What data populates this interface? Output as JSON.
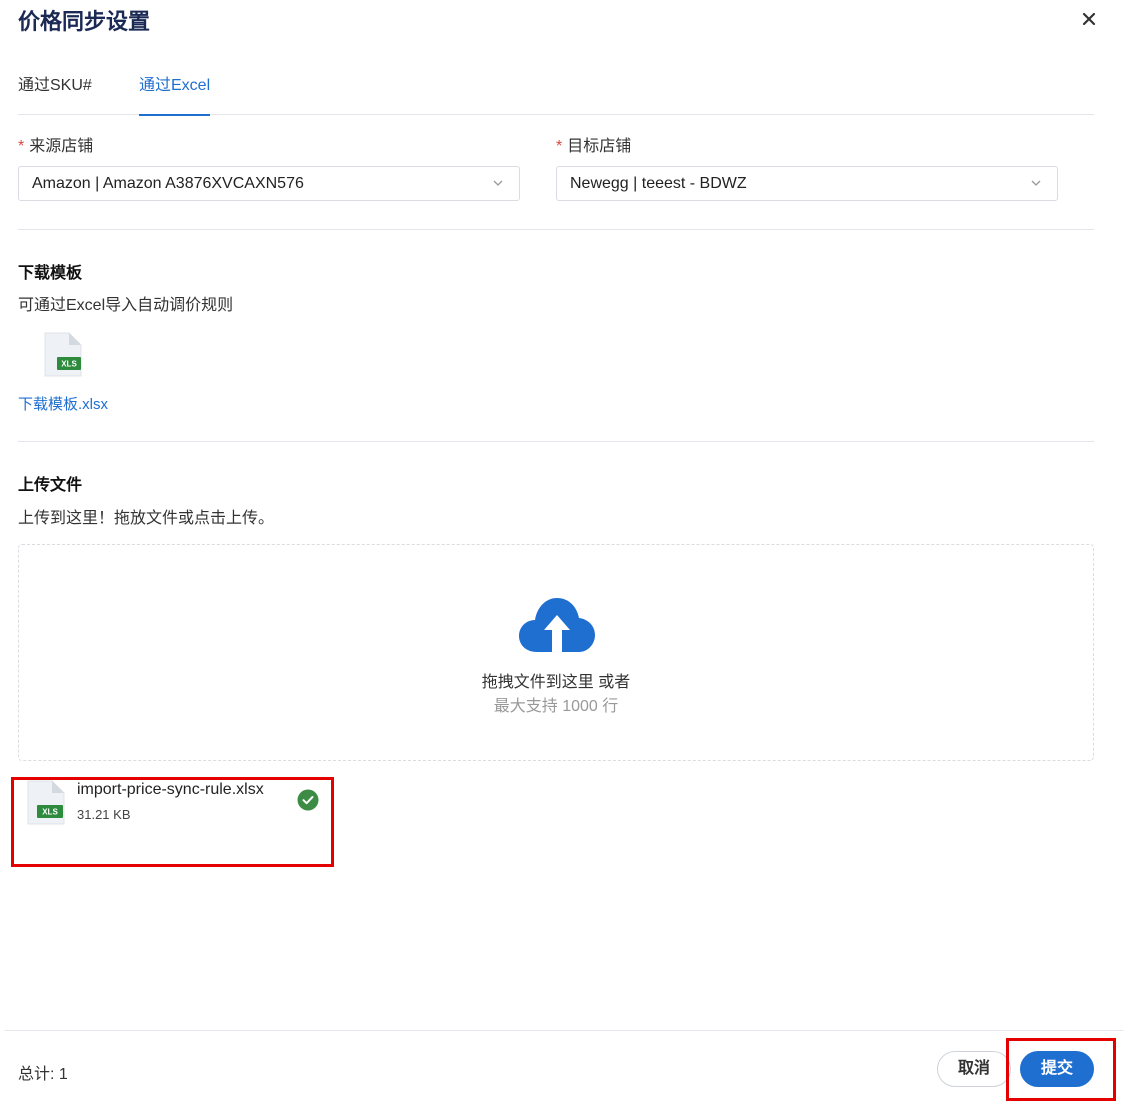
{
  "dialog": {
    "title": "价格同步设置"
  },
  "tabs": [
    {
      "label": "通过SKU#",
      "active": false
    },
    {
      "label": "通过Excel",
      "active": true
    }
  ],
  "source_store": {
    "required_mark": "*",
    "label": "来源店铺",
    "value": "Amazon | Amazon A3876XVCAXN576"
  },
  "target_store": {
    "required_mark": "*",
    "label": "目标店铺",
    "value": "Newegg | teeest - BDWZ"
  },
  "download": {
    "heading": "下载模板",
    "description": "可通过Excel导入自动调价规则",
    "file_badge": "XLS",
    "link_text": "下载模板.xlsx"
  },
  "upload": {
    "heading": "上传文件",
    "description": "上传到这里！拖放文件或点击上传。",
    "drag_text": "拖拽文件到这里 或者",
    "limit_text": "最大支持 1000 行"
  },
  "uploaded_file": {
    "badge": "XLS",
    "name": "import-price-sync-rule.xlsx",
    "size": "31.21 KB",
    "status": "success"
  },
  "footer": {
    "total": "总计: 1",
    "cancel_label": "取消",
    "submit_label": "提交"
  },
  "colors": {
    "accent": "#1f6fd1",
    "title": "#1b2a55",
    "required": "#e0463b",
    "success": "#3c8c46",
    "highlight": "#e50000"
  },
  "icons": [
    "close-icon",
    "chevron-down-icon",
    "xls-file-icon",
    "cloud-upload-icon",
    "check-circle-icon"
  ]
}
